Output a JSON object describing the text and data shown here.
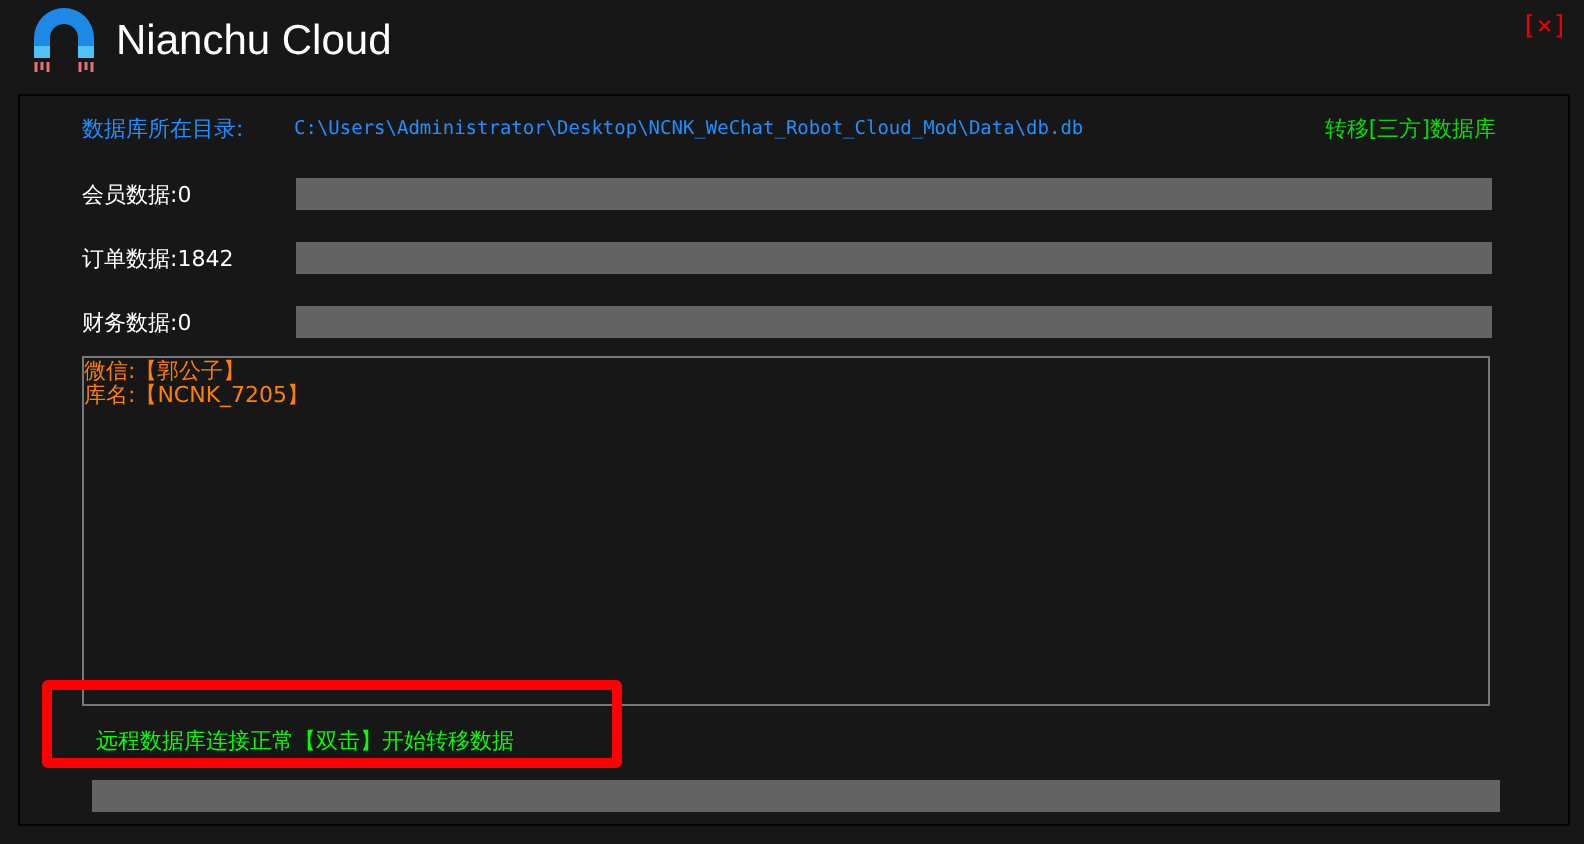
{
  "window": {
    "title": "Nianchu Cloud",
    "close": "[×]"
  },
  "database": {
    "label": "数据库所在目录:",
    "path": "C:\\Users\\Administrator\\Desktop\\NCNK_WeChat_Robot_Cloud_Mod\\Data\\db.db",
    "action": "转移[三方]数据库"
  },
  "stats": [
    {
      "label": "会员数据:0"
    },
    {
      "label": "订单数据:1842"
    },
    {
      "label": "财务数据:0"
    }
  ],
  "log": [
    "微信:【郭公子】",
    "库名:【NCNK_7205】"
  ],
  "status": {
    "message": "远程数据库连接正常【双击】开始转移数据",
    "highlighted": true
  }
}
